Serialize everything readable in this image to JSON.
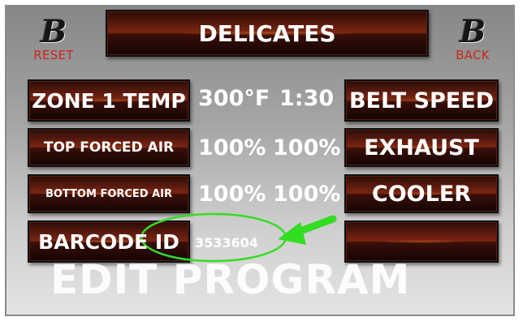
{
  "header": {
    "title": "DELICATES",
    "reset_label": "RESET",
    "back_label": "BACK",
    "logo_glyph": "B"
  },
  "rows": [
    {
      "label": "ZONE 1 TEMP",
      "value1": "300°F",
      "value2": "1:30",
      "action": "BELT SPEED"
    },
    {
      "label": "TOP FORCED AIR",
      "value1": "100%",
      "value2": "100%",
      "action": "EXHAUST"
    },
    {
      "label": "BOTTOM FORCED AIR",
      "value1": "100%",
      "value2": "100%",
      "action": "COOLER"
    },
    {
      "label": "BARCODE ID",
      "value1": "3533604",
      "action": ""
    }
  ],
  "footer": {
    "mode_label": "EDIT PROGRAM"
  },
  "annotation": {
    "color": "#33dd22",
    "shape": "ellipse-with-arrow"
  },
  "colors": {
    "panel_dark": "#2a0c07",
    "panel_glow": "#7c2512",
    "logo_caption": "#c8281d",
    "text": "#ffffff"
  }
}
